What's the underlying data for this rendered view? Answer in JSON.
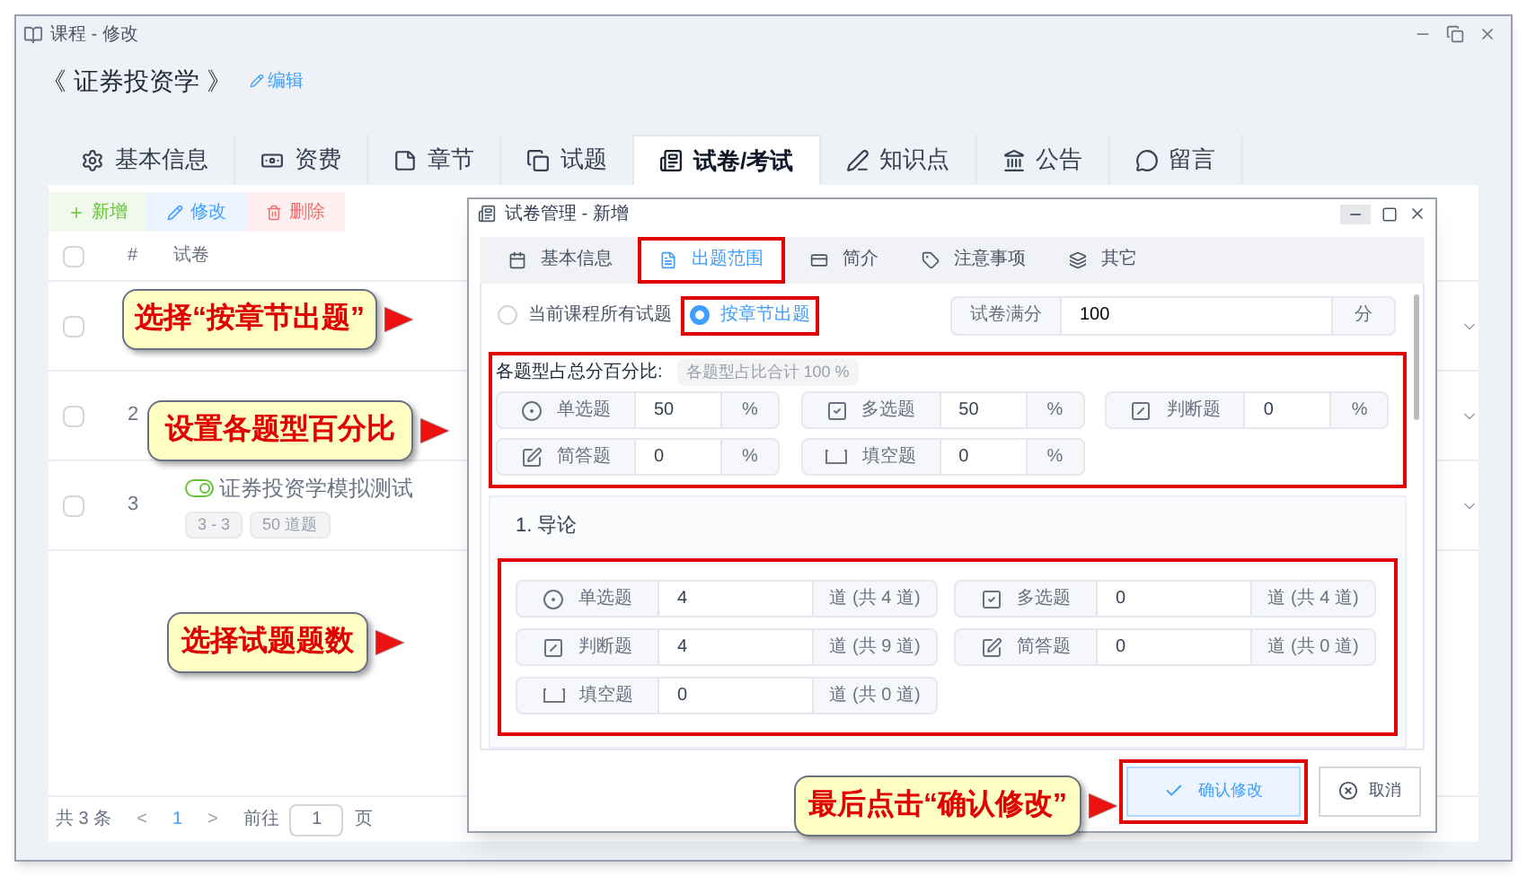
{
  "window": {
    "title": "课程 - 修改"
  },
  "course": {
    "title": "《 证券投资学 》",
    "edit_link": "编辑"
  },
  "tabs": [
    {
      "label": "基本信息",
      "selected": false
    },
    {
      "label": "资费",
      "selected": false
    },
    {
      "label": "章节",
      "selected": false
    },
    {
      "label": "试题",
      "selected": false
    },
    {
      "label": "试卷/考试",
      "selected": true
    },
    {
      "label": "知识点",
      "selected": false
    },
    {
      "label": "公告",
      "selected": false
    },
    {
      "label": "留言",
      "selected": false
    }
  ],
  "toolbar": [
    {
      "label": "新增",
      "kind": "add"
    },
    {
      "label": "修改",
      "kind": "edit"
    },
    {
      "label": "删除",
      "kind": "delete"
    }
  ],
  "table": {
    "all_checked": false,
    "columns": [
      "#",
      "试卷"
    ],
    "rows": [
      {
        "checked": false
      },
      {
        "checked": false,
        "number": "2"
      },
      {
        "checked": false,
        "number": "3",
        "title": "证券投资学模拟测试",
        "on": true,
        "tags": [
          "3 - 3",
          "50 道题"
        ]
      }
    ]
  },
  "pagination": {
    "total": "共 3 条",
    "prev": "<",
    "pages": [
      {
        "label": "1",
        "selected": true
      }
    ],
    "next": ">",
    "goto_label": "前往",
    "goto_value": "1",
    "page_unit": "页"
  },
  "dialog": {
    "title": "试卷管理 - 新增",
    "tabs": [
      {
        "label": "基本信息",
        "selected": false
      },
      {
        "label": "出题范围",
        "selected": true
      },
      {
        "label": "简介",
        "selected": false
      },
      {
        "label": "注意事项",
        "selected": false
      },
      {
        "label": "其它",
        "selected": false
      }
    ],
    "source_options": [
      {
        "label": "当前课程所有试题",
        "selected": false
      },
      {
        "label": "按章节出题",
        "selected": true
      }
    ],
    "full_score": {
      "label": "试卷满分",
      "value": "100",
      "unit": "分"
    },
    "percent": {
      "label": "各题型占总分百分比:",
      "total_badge": "各题型占比合计 100 %",
      "fields": [
        {
          "kind": "single",
          "label": "单选题",
          "value": "50",
          "unit": "%"
        },
        {
          "kind": "multi",
          "label": "多选题",
          "value": "50",
          "unit": "%"
        },
        {
          "kind": "judge",
          "label": "判断题",
          "value": "0",
          "unit": "%"
        },
        {
          "kind": "short",
          "label": "简答题",
          "value": "0",
          "unit": "%"
        },
        {
          "kind": "blank",
          "label": "填空题",
          "value": "0",
          "unit": "%"
        }
      ]
    },
    "chapters": [
      {
        "title": "1. 导论",
        "fields": [
          {
            "kind": "single",
            "label": "单选题",
            "value": "4",
            "unit": "道 (共 4 道)"
          },
          {
            "kind": "multi",
            "label": "多选题",
            "value": "0",
            "unit": "道 (共 4 道)"
          },
          {
            "kind": "judge",
            "label": "判断题",
            "value": "4",
            "unit": "道 (共 9 道)"
          },
          {
            "kind": "short",
            "label": "简答题",
            "value": "0",
            "unit": "道 (共 0 道)"
          },
          {
            "kind": "blank",
            "label": "填空题",
            "value": "0",
            "unit": "道 (共 0 道)"
          }
        ]
      }
    ],
    "buttons": [
      {
        "label": "确认修改",
        "kind": "confirm"
      },
      {
        "label": "取消",
        "kind": "cancel"
      }
    ]
  },
  "annotations": [
    {
      "text": "选择“按章节出题”"
    },
    {
      "text": "设置各题型百分比"
    },
    {
      "text": "选择试题题数"
    },
    {
      "text": "最后点击“确认修改”"
    }
  ]
}
